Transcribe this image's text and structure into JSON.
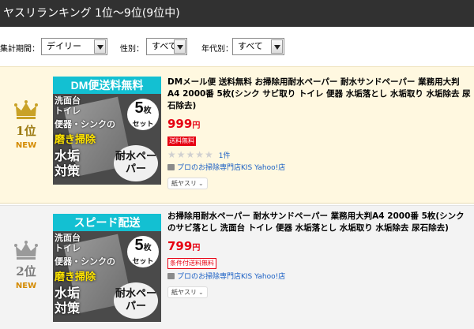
{
  "header": {
    "title": "ヤスリランキング 1位〜9位(9位中)"
  },
  "filters": {
    "period": {
      "label": "集計期間：",
      "value": "デイリー"
    },
    "gender": {
      "label": "性別：",
      "value": "すべて"
    },
    "age": {
      "label": "年代別：",
      "value": "すべて"
    }
  },
  "items": [
    {
      "rank_label": "1位",
      "new_label": "NEW",
      "crown": "gold-crown-icon",
      "image": {
        "banner": "DM便送料無料",
        "line1": "洗面台",
        "line2": "トイレ",
        "line3": "便器・シンクの",
        "line4": "磨き掃除",
        "line5": "水垢",
        "line6": "対策",
        "count": "5",
        "count_unit": "枚",
        "set": "セット",
        "waterproof": "耐水ペーパー"
      },
      "title": "DMメール便 送料無料 お掃除用耐水ペーパー 耐水サンドペーパー 業務用大判A4 2000番 5枚(シンク サビ取り トイレ 便器 水垢落とし 水垢取り 水垢除去 尿石除去)",
      "price": "999",
      "price_unit": "円",
      "badge": "送料無料",
      "review_count": "1件",
      "store": "プロのお掃除専門店KIS Yahoo!店",
      "category": "紙ヤスリ"
    },
    {
      "rank_label": "2位",
      "new_label": "NEW",
      "crown": "silver-crown-icon",
      "image": {
        "banner": "スピード配送",
        "line1": "洗面台",
        "line2": "トイレ",
        "line3": "便器・シンクの",
        "line4": "磨き掃除",
        "line5": "水垢",
        "line6": "対策",
        "count": "5",
        "count_unit": "枚",
        "set": "セット",
        "waterproof": "耐水ペーパー"
      },
      "title": "お掃除用耐水ペーパー 耐水サンドペーパー 業務用大判A4 2000番 5枚(シンクのサビ落とし 洗面台 トイレ 便器 水垢落とし 水垢取り 水垢除去 尿石除去)",
      "price": "799",
      "price_unit": "円",
      "badge": "条件付送料無料",
      "store": "プロのお掃除専門店KIS Yahoo!店",
      "category": "紙ヤスリ"
    }
  ],
  "colors": {
    "header_bg": "#313131",
    "price": "#e60012",
    "link": "#1a5fc4",
    "rank1_bg": "#fff8e0",
    "rank2_bg": "#f3f3f3"
  }
}
